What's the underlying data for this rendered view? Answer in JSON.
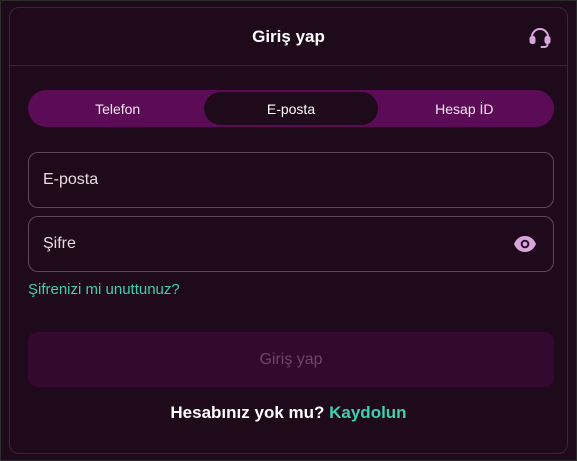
{
  "header": {
    "title": "Giriş yap",
    "support_icon": "headset-icon"
  },
  "tabs": [
    {
      "label": "Telefon",
      "active": false
    },
    {
      "label": "E-posta",
      "active": true
    },
    {
      "label": "Hesap İD",
      "active": false
    }
  ],
  "form": {
    "email_placeholder": "E-posta",
    "email_value": "",
    "password_placeholder": "Şifre",
    "password_value": "",
    "eye_icon": "eye-icon",
    "forgot_label": "Şifrenizi mi unuttunuz?",
    "submit_label": "Giriş yap"
  },
  "signup": {
    "question": "Hesabınız yok mu?",
    "link": "Kaydolun"
  },
  "colors": {
    "background": "#1f0a1c",
    "tab_bar": "#5c0c56",
    "accent": "#3fcfae",
    "button_disabled": "#33092f"
  }
}
